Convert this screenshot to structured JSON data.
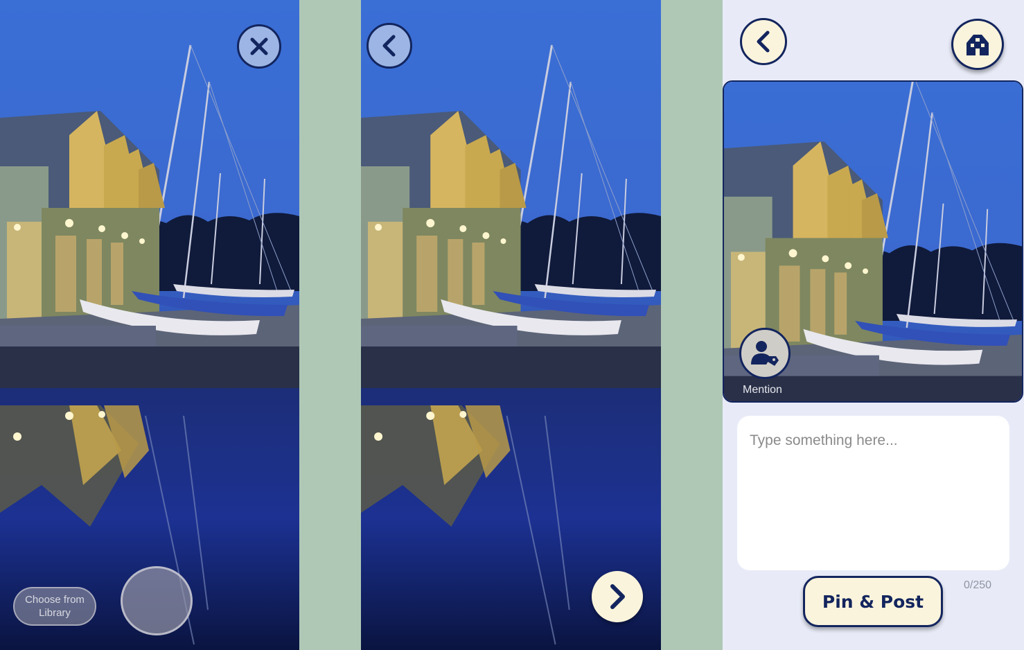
{
  "colors": {
    "navy": "#13255e",
    "cream": "#fbf4dc",
    "gutter_green": "#afc8b6",
    "post_background": "#e8ebf7"
  },
  "camera_screen": {
    "close_icon": "close-icon",
    "library_button_label": "Choose from Library",
    "shutter_icon": "shutter-button"
  },
  "preview_screen": {
    "back_icon": "chevron-left-icon",
    "next_icon": "chevron-right-icon"
  },
  "post_screen": {
    "back_icon": "chevron-left-icon",
    "home_icon": "house-icon",
    "mention_label": "Mention",
    "caption_placeholder": "Type something here...",
    "char_count": "0/250",
    "submit_label": "Pin & Post"
  }
}
